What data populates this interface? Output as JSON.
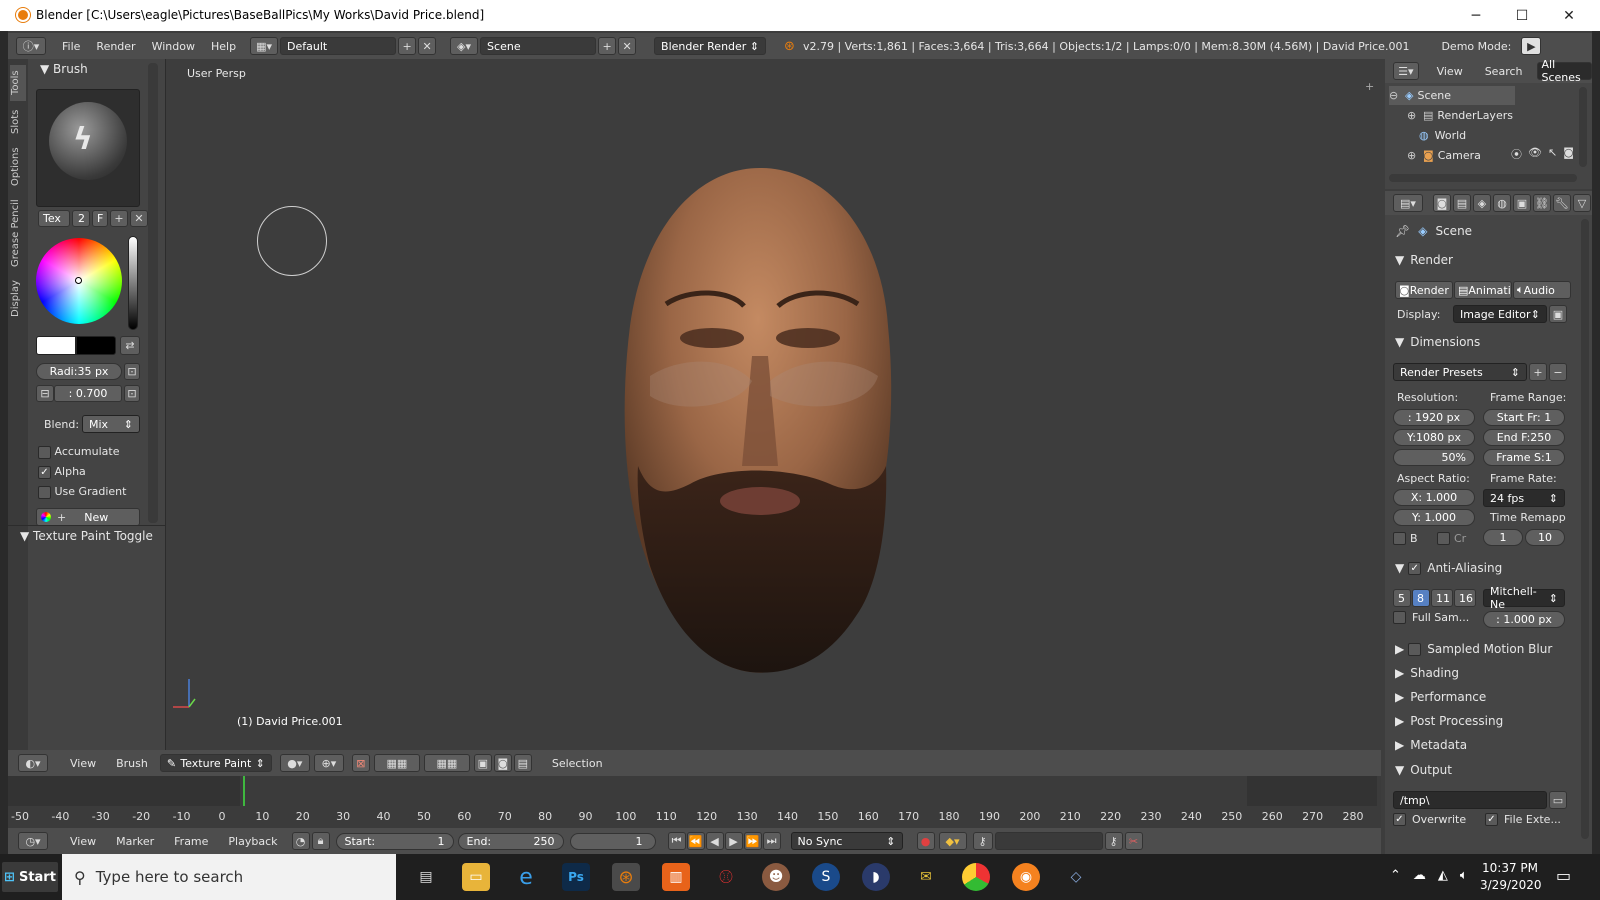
{
  "window": {
    "title": "Blender [C:\\Users\\eagle\\Pictures\\BaseBallPics\\My Works\\David Price.blend]",
    "minimize": "─",
    "maximize": "☐",
    "close": "✕"
  },
  "infobar": {
    "menus": [
      "File",
      "Render",
      "Window",
      "Help"
    ],
    "layout": "Default",
    "scene": "Scene",
    "engine": "Blender Render",
    "stats": "v2.79 | Verts:1,861 | Faces:3,664 | Tris:3,664 | Objects:1/2 | Lamps:0/0 | Mem:8.30M (4.56M) | David Price.001",
    "demo_mode": "Demo Mode:"
  },
  "toolshelf": {
    "tabs": [
      "Tools",
      "Slots",
      "Options",
      "Grease Pencil",
      "Display"
    ],
    "brush_header": "Brush",
    "tex_label": "Tex",
    "tex_num": "2",
    "tex_f": "F",
    "radius": "Radi:35 px",
    "strength": ": 0.700",
    "blend_label": "Blend:",
    "blend_value": "Mix",
    "accumulate": "Accumulate",
    "alpha": "Alpha",
    "use_gradient": "Use Gradient",
    "new_label": "New",
    "texture_paint_toggle": "Texture Paint Toggle"
  },
  "viewport": {
    "view_label": "User Persp",
    "object_label": "(1) David Price.001"
  },
  "header3d": {
    "view": "View",
    "brush": "Brush",
    "mode": "Texture Paint",
    "selection": "Selection"
  },
  "timeline": {
    "ticks": [
      "-50",
      "-40",
      "-30",
      "-20",
      "-10",
      "0",
      "10",
      "20",
      "30",
      "40",
      "50",
      "60",
      "70",
      "80",
      "90",
      "100",
      "110",
      "120",
      "130",
      "140",
      "150",
      "160",
      "170",
      "180",
      "190",
      "200",
      "210",
      "220",
      "230",
      "240",
      "250",
      "260",
      "270",
      "280"
    ],
    "menus": [
      "View",
      "Marker",
      "Frame",
      "Playback"
    ],
    "start_label": "Start:",
    "start_value": "1",
    "end_label": "End:",
    "end_value": "250",
    "current": "1",
    "sync": "No Sync"
  },
  "outliner": {
    "view": "View",
    "search": "Search",
    "all_scenes": "All Scenes",
    "items": [
      "Scene",
      "RenderLayers",
      "World",
      "Camera"
    ]
  },
  "properties": {
    "scene": "Scene",
    "render_section": "Render",
    "render_btn": "Render",
    "anim_btn": "Animati",
    "audio_btn": "Audio",
    "display_label": "Display:",
    "display_value": "Image Editor",
    "dimensions": "Dimensions",
    "render_presets": "Render Presets",
    "resolution_label": "Resolution:",
    "frame_range_label": "Frame Range:",
    "res_x": ": 1920 px",
    "res_y": "Y:1080 px",
    "res_pct": "50%",
    "start_fr": "Start Fr: 1",
    "end_fr": "End F:250",
    "frame_step": "Frame S:1",
    "aspect_label": "Aspect Ratio:",
    "frame_rate_label": "Frame Rate:",
    "asp_x": "X:  1.000",
    "asp_y": "Y:  1.000",
    "fps": "24 fps",
    "time_remap": "Time Remapp",
    "b_label": "B",
    "cr_label": "Cr",
    "remap_old": "1",
    "remap_new": "10",
    "anti_aliasing": "Anti-Aliasing",
    "aa_samples": [
      "5",
      "8",
      "11",
      "16"
    ],
    "aa_filter": "Mitchell-Ne",
    "full_sample": "Full Sam...",
    "filter_size": ": 1.000 px",
    "collapsed": [
      "Sampled Motion Blur",
      "Shading",
      "Performance",
      "Post Processing",
      "Metadata"
    ],
    "output": "Output",
    "output_path": "/tmp\\",
    "overwrite": "Overwrite",
    "file_ext": "File Exte..."
  },
  "taskbar": {
    "start": "Start",
    "search_placeholder": "Type here to search",
    "time": "10:37 PM",
    "date": "3/29/2020"
  }
}
